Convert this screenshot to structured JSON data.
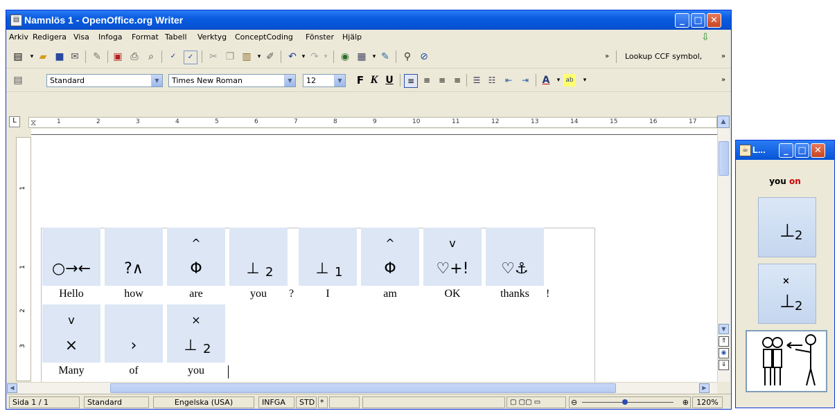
{
  "writer": {
    "title": "Namnlös 1 - OpenOffice.org Writer",
    "menu": [
      "Arkiv",
      "Redigera",
      "Visa",
      "Infoga",
      "Format",
      "Tabell",
      "Verktyg",
      "ConceptCoding",
      "Fönster",
      "Hjälp"
    ],
    "lookup_label": "Lookup CCF symbol,",
    "style_value": "Standard",
    "font_value": "Times New Roman",
    "size_value": "12",
    "format_labels": {
      "bold": "F",
      "italic": "K",
      "underline": "U"
    },
    "ruler_numbers": [
      "1",
      "2",
      "3",
      "4",
      "5",
      "6",
      "7",
      "8",
      "9",
      "10",
      "11",
      "12",
      "13",
      "14",
      "15",
      "16",
      "17"
    ],
    "vruler_numbers": [
      "1",
      "1",
      "2",
      "3"
    ],
    "symbols_row1": [
      {
        "glyph": "○→←",
        "word": "Hello"
      },
      {
        "glyph": "?∧",
        "word": "how"
      },
      {
        "glyph": "Φ",
        "mark": "^",
        "word": "are"
      },
      {
        "glyph": "⊥",
        "sub": "2",
        "word": "you"
      },
      {
        "glyph": "⊥",
        "sub": "1",
        "word": "I"
      },
      {
        "glyph": "Φ",
        "mark": "^",
        "word": "am"
      },
      {
        "glyph": "♡+!",
        "mark": "v",
        "word": "OK"
      },
      {
        "glyph": "♡⚓",
        "word": "thanks"
      }
    ],
    "symbols_row2": [
      {
        "glyph": "×",
        "mark": "v",
        "word": "Many"
      },
      {
        "glyph": "›",
        "word": "of"
      },
      {
        "glyph": "⊥",
        "sub": "2",
        "mark": "×",
        "word": "you"
      }
    ],
    "punct_after_you": "?",
    "punct_after_thanks": "!",
    "status": {
      "page": "Sida  1 / 1",
      "style": "Standard",
      "language": "Engelska (USA)",
      "insert": "INFGA",
      "selection": "STD",
      "modified": "*",
      "zoom": "120%",
      "zoom_level": 0.47
    }
  },
  "lookup_window": {
    "title": "L...",
    "text_you": "you",
    "text_on": "on",
    "colors": {
      "on": "#cc0000"
    },
    "symbol1": {
      "glyph": "⊥",
      "sub": "2"
    },
    "symbol2": {
      "glyph": "⊥",
      "sub": "2",
      "mark": "×"
    }
  }
}
